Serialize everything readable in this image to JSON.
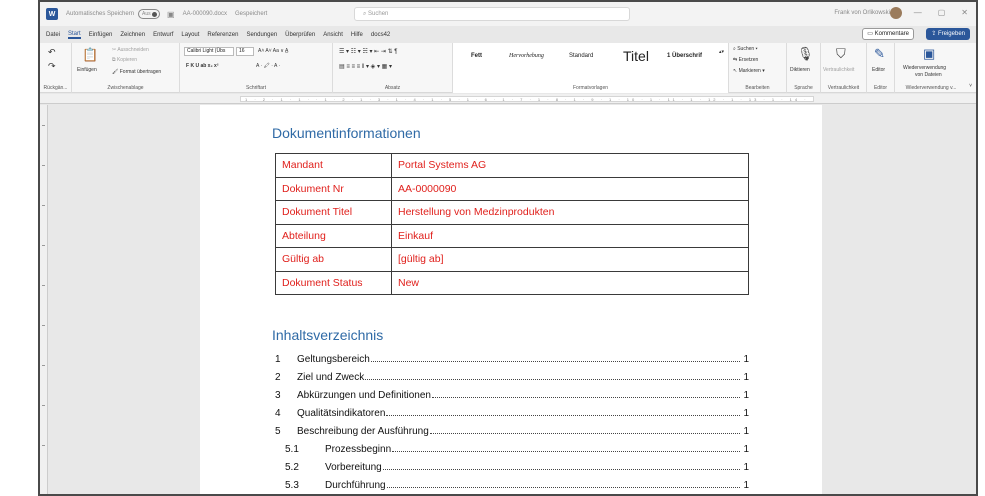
{
  "titlebar": {
    "autosave": "Automatisches Speichern",
    "autosave_state": "Aus",
    "doc": "AA-000090.docx",
    "saved": "Gespeichert",
    "search": "Suchen",
    "user": "Frank von Orlikowski"
  },
  "menu": {
    "tabs": [
      "Datei",
      "Start",
      "Einfügen",
      "Zeichnen",
      "Entwurf",
      "Layout",
      "Referenzen",
      "Sendungen",
      "Überprüfen",
      "Ansicht",
      "Hilfe",
      "docs42"
    ],
    "active": "Start",
    "comments": "Kommentare",
    "share": "Freigeben"
  },
  "ribbon": {
    "undo_label": "Rückgän...",
    "clipboard": {
      "label": "Zwischenablage",
      "paste": "Einfügen",
      "cut": "Ausschneiden",
      "copy": "Kopieren",
      "format": "Format übertragen"
    },
    "font": {
      "label": "Schriftart",
      "name": "Calibri Light (Übs",
      "size": "16",
      "format_row": "F K U ab x₂ x²"
    },
    "paragraph": {
      "label": "Absatz"
    },
    "styles": {
      "label": "Formatvorlagen",
      "items": [
        "Fett",
        "Hervorhebung",
        "Standard",
        "Titel",
        "1 Überschrif"
      ]
    },
    "editing": {
      "label": "Bearbeiten",
      "search": "Suchen",
      "replace": "Ersetzen",
      "select": "Markieren"
    },
    "voice": {
      "label": "Sprache",
      "button": "Diktieren"
    },
    "sensitivity": {
      "label": "Vertraulichkeit",
      "button": "Vertraulichkeit"
    },
    "editor": {
      "label": "Editor",
      "button": "Editor"
    },
    "reuse": {
      "label": "Wiederverwendung v...",
      "button_line1": "Wiederverwendung",
      "button_line2": "von Dateien"
    }
  },
  "ruler": {
    "marks": "1 · 2 · 1 · 1 · · 1 · 2 · 1 · 3 · 1 · 4 · 1 · 5 · 1 · 6 · 1 · 7 · 1 · 8 · 1 · 9 · 1 · 10 · 1 · 11 · 1 · 12 · 1 · 13 · 1 · 14 · 1 · 15 · 1 · 17 · 1 · 18"
  },
  "document": {
    "info_heading": "Dokumentinformationen",
    "info_rows": [
      {
        "label": "Mandant",
        "value": "Portal Systems AG"
      },
      {
        "label": "Dokument Nr",
        "value": "AA-0000090"
      },
      {
        "label": "Dokument Titel",
        "value": "Herstellung von Medzinprodukten"
      },
      {
        "label": "Abteilung",
        "value": "Einkauf"
      },
      {
        "label": "Gültig ab",
        "value": "[gültig ab]"
      },
      {
        "label": "Dokument Status",
        "value": "New"
      }
    ],
    "toc_heading": "Inhaltsverzeichnis",
    "toc": [
      {
        "num": "1",
        "text": "Geltungsbereich",
        "page": "1"
      },
      {
        "num": "2",
        "text": "Ziel und Zweck",
        "page": "1"
      },
      {
        "num": "3",
        "text": "Abkürzungen und Definitionen",
        "page": "1"
      },
      {
        "num": "4",
        "text": "Qualitätsindikatoren",
        "page": "1"
      },
      {
        "num": "5",
        "text": "Beschreibung der Ausführung",
        "page": "1"
      },
      {
        "num": "5.1",
        "text": "Prozessbeginn",
        "page": "1"
      },
      {
        "num": "5.2",
        "text": "Vorbereitung",
        "page": "1"
      },
      {
        "num": "5.3",
        "text": "Durchführung",
        "page": "1"
      }
    ]
  },
  "colors": {
    "accent": "#2b579a",
    "heading": "#2f6aa6",
    "table_text": "#e0201c"
  }
}
